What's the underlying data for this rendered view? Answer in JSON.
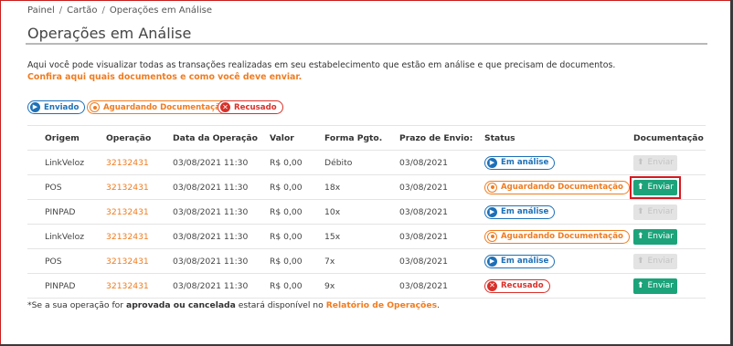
{
  "breadcrumb": [
    "Painel",
    "Cartão",
    "Operações em Análise"
  ],
  "page_title": "Operações em Análise",
  "intro": {
    "text": "Aqui você pode visualizar todas as transações realizadas em seu estabelecimento que estão em análise e que precisam de documentos.",
    "link": "Confira aqui quais documentos e como você deve enviar."
  },
  "legend": {
    "enviado": "Enviado",
    "aguardando": "Aguardando Documentação",
    "recusado": "Recusado"
  },
  "table": {
    "headers": [
      "Origem",
      "Operação",
      "Data da Operação",
      "Valor",
      "Forma Pgto.",
      "Prazo de Envio:",
      "Status",
      "Documentação"
    ],
    "rows": [
      {
        "origem": "LinkVeloz",
        "operacao": "32132431",
        "data": "03/08/2021 11:30",
        "valor": "R$ 0,00",
        "forma": "Débito",
        "prazo": "03/08/2021",
        "status": "Em análise",
        "status_kind": "blue",
        "doc": "Enviar",
        "doc_enabled": false
      },
      {
        "origem": "POS",
        "operacao": "32132431",
        "data": "03/08/2021 11:30",
        "valor": "R$ 0,00",
        "forma": "18x",
        "prazo": "03/08/2021",
        "status": "Aguardando Documentação",
        "status_kind": "orange",
        "doc": "Enviar",
        "doc_enabled": true
      },
      {
        "origem": "PINPAD",
        "operacao": "32132431",
        "data": "03/08/2021 11:30",
        "valor": "R$ 0,00",
        "forma": "10x",
        "prazo": "03/08/2021",
        "status": "Em análise",
        "status_kind": "blue",
        "doc": "Enviar",
        "doc_enabled": false
      },
      {
        "origem": "LinkVeloz",
        "operacao": "32132431",
        "data": "03/08/2021 11:30",
        "valor": "R$ 0,00",
        "forma": "15x",
        "prazo": "03/08/2021",
        "status": "Aguardando Documentação",
        "status_kind": "orange",
        "doc": "Enviar",
        "doc_enabled": true
      },
      {
        "origem": "POS",
        "operacao": "32132431",
        "data": "03/08/2021 11:30",
        "valor": "R$ 0,00",
        "forma": "7x",
        "prazo": "03/08/2021",
        "status": "Em análise",
        "status_kind": "blue",
        "doc": "Enviar",
        "doc_enabled": false
      },
      {
        "origem": "PINPAD",
        "operacao": "32132431",
        "data": "03/08/2021 11:30",
        "valor": "R$ 0,00",
        "forma": "9x",
        "prazo": "03/08/2021",
        "status": "Recusado",
        "status_kind": "red",
        "doc": "Enviar",
        "doc_enabled": true
      }
    ]
  },
  "footnote": {
    "prefix": "*Se a sua operação for ",
    "bold": "aprovada ou cancelada",
    "middle": " estará disponível no ",
    "link": "Relatório de Operações",
    "suffix": "."
  },
  "colors": {
    "accent": "#f07c20",
    "blue": "#1d70b7",
    "red": "#d9302a",
    "green": "#1ca37a",
    "highlight": "#d71920"
  },
  "icons": {
    "blue": "play-circle-icon",
    "orange": "hourglass-circle-icon",
    "red": "x-circle-icon",
    "upload": "upload-arrow-icon"
  }
}
